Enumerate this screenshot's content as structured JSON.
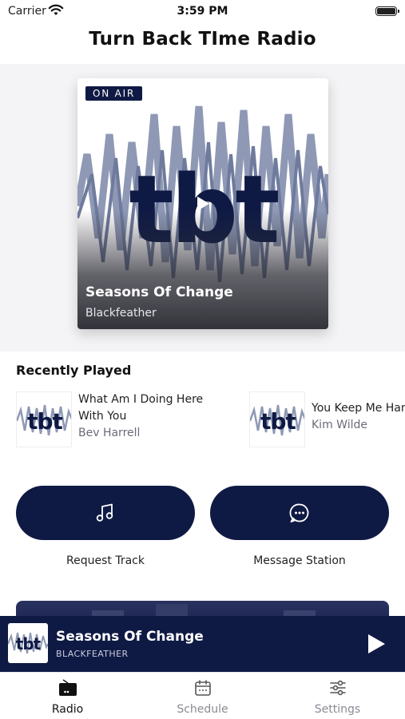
{
  "status_bar": {
    "carrier": "Carrier",
    "time": "3:59 PM"
  },
  "app": {
    "title": "Turn Back TIme Radio"
  },
  "now_playing": {
    "badge": "ON AIR",
    "title": "Seasons Of Change",
    "artist": "Blackfeather",
    "artwork_text": "tbt"
  },
  "recently_played": {
    "heading": "Recently Played",
    "items": [
      {
        "title_line1": "What Am I Doing Here",
        "title_line2": "With You",
        "artist": "Bev Harrell",
        "artwork_text": "tbt"
      },
      {
        "title_line1": "You Keep Me Hangin' On",
        "title_line2": "",
        "artist": "Kim Wilde",
        "artwork_text": "tbt"
      }
    ]
  },
  "actions": {
    "request": {
      "label": "Request Track",
      "icon": "music-note-icon"
    },
    "message": {
      "label": "Message Station",
      "icon": "chat-bubble-icon"
    }
  },
  "mini_player": {
    "title": "Seasons Of Change",
    "artist": "BLACKFEATHER",
    "artwork_text": "tbt"
  },
  "tabs": [
    {
      "label": "Radio",
      "icon": "radio-icon",
      "active": true
    },
    {
      "label": "Schedule",
      "icon": "calendar-icon",
      "active": false
    },
    {
      "label": "Settings",
      "icon": "sliders-icon",
      "active": false
    }
  ],
  "colors": {
    "navy": "#0f1a44",
    "wave": "#7f8aa8"
  }
}
